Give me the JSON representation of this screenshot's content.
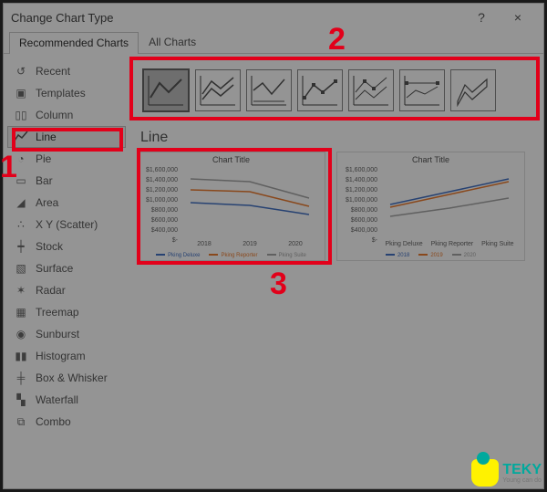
{
  "dialog": {
    "title": "Change Chart Type",
    "help": "?",
    "close": "×"
  },
  "tabs": {
    "recommended": "Recommended Charts",
    "all": "All Charts"
  },
  "sidebar": {
    "items": [
      {
        "label": "Recent"
      },
      {
        "label": "Templates"
      },
      {
        "label": "Column"
      },
      {
        "label": "Line"
      },
      {
        "label": "Pie"
      },
      {
        "label": "Bar"
      },
      {
        "label": "Area"
      },
      {
        "label": "X Y (Scatter)"
      },
      {
        "label": "Stock"
      },
      {
        "label": "Surface"
      },
      {
        "label": "Radar"
      },
      {
        "label": "Treemap"
      },
      {
        "label": "Sunburst"
      },
      {
        "label": "Histogram"
      },
      {
        "label": "Box & Whisker"
      },
      {
        "label": "Waterfall"
      },
      {
        "label": "Combo"
      }
    ]
  },
  "subtype_heading": "Line",
  "preview1": {
    "title": "Chart Title",
    "y": [
      "$1,600,000",
      "$1,400,000",
      "$1,200,000",
      "$1,000,000",
      "$800,000",
      "$600,000",
      "$400,000",
      "$-"
    ],
    "x": [
      "2018",
      "2019",
      "2020"
    ],
    "legend": [
      "Pking Deluxe",
      "Pking Reporter",
      "Pking Suite"
    ]
  },
  "preview2": {
    "title": "Chart Title",
    "y": [
      "$1,600,000",
      "$1,400,000",
      "$1,200,000",
      "$1,000,000",
      "$800,000",
      "$600,000",
      "$400,000",
      "$-"
    ],
    "x": [
      "Pking Deluxe",
      "Pking Reporter",
      "Pking Suite"
    ],
    "legend": [
      "2018",
      "2019",
      "2020"
    ]
  },
  "callouts": {
    "n1": "1",
    "n2": "2",
    "n3": "3"
  },
  "watermark": {
    "brand": "TEKY",
    "sub": "Young can do"
  },
  "chart_data": [
    {
      "type": "line",
      "title": "Chart Title",
      "categories": [
        "2018",
        "2019",
        "2020"
      ],
      "series": [
        {
          "name": "Pking Deluxe",
          "values": [
            800000,
            750000,
            550000
          ]
        },
        {
          "name": "Pking Reporter",
          "values": [
            1100000,
            1050000,
            700000
          ]
        },
        {
          "name": "Pking Suite",
          "values": [
            1350000,
            1300000,
            900000
          ]
        }
      ],
      "xlabel": "",
      "ylabel": "",
      "ylim": [
        0,
        1600000
      ]
    },
    {
      "type": "line",
      "title": "Chart Title",
      "categories": [
        "Pking Deluxe",
        "Pking Reporter",
        "Pking Suite"
      ],
      "series": [
        {
          "name": "2018",
          "values": [
            800000,
            1100000,
            1350000
          ]
        },
        {
          "name": "2019",
          "values": [
            750000,
            1050000,
            1300000
          ]
        },
        {
          "name": "2020",
          "values": [
            550000,
            700000,
            900000
          ]
        }
      ],
      "xlabel": "",
      "ylabel": "",
      "ylim": [
        0,
        1600000
      ]
    }
  ]
}
